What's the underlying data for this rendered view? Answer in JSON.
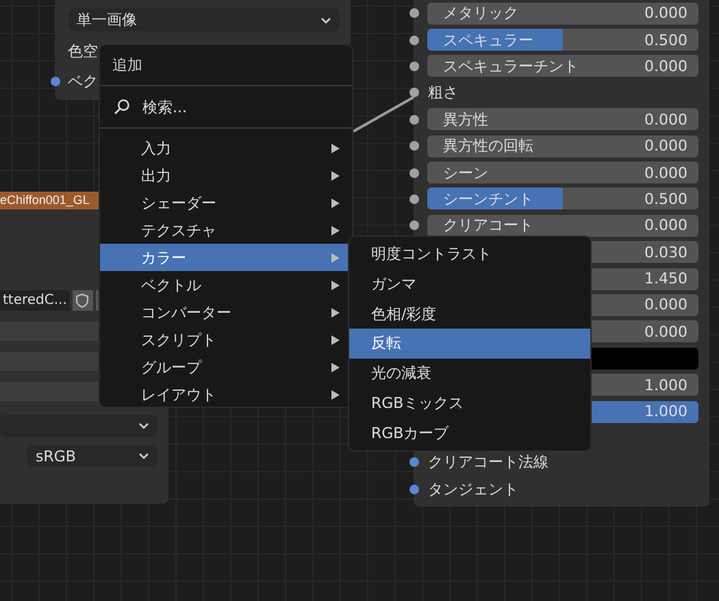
{
  "image_node": {
    "dropdown": "単一画像",
    "rows": [
      {
        "label": "色空"
      },
      {
        "label": "ベク",
        "color": "#5b84d6"
      }
    ]
  },
  "texture_node": {
    "title": "eChiffon001_GL",
    "image_field": "tteredC...",
    "colorspace": "sRGB"
  },
  "add_menu": {
    "title": "追加",
    "search": "検索...",
    "items": [
      {
        "label": "入力",
        "selected": false
      },
      {
        "label": "出力",
        "selected": false
      },
      {
        "label": "シェーダー",
        "selected": false
      },
      {
        "label": "テクスチャ",
        "selected": false
      },
      {
        "label": "カラー",
        "selected": true
      },
      {
        "label": "ベクトル",
        "selected": false
      },
      {
        "label": "コンバーター",
        "selected": false
      },
      {
        "label": "スクリプト",
        "selected": false
      },
      {
        "label": "グループ",
        "selected": false
      },
      {
        "label": "レイアウト",
        "selected": false
      }
    ]
  },
  "color_submenu": {
    "items": [
      {
        "label": "明度コントラスト",
        "selected": false
      },
      {
        "label": "ガンマ",
        "selected": false
      },
      {
        "label": "色相/彩度",
        "selected": false
      },
      {
        "label": "反転",
        "selected": true
      },
      {
        "label": "光の減衰",
        "selected": false
      },
      {
        "label": "RGBミックス",
        "selected": false
      },
      {
        "label": "RGBカーブ",
        "selected": false
      }
    ]
  },
  "bsdf_node": {
    "rows": [
      {
        "kind": "slider",
        "label": "メタリック",
        "value": "0.000",
        "level": 0,
        "color": "#a1a1a1"
      },
      {
        "kind": "slider",
        "label": "スペキュラー",
        "value": "0.500",
        "level": 0.5,
        "color": "#a1a1a1"
      },
      {
        "kind": "slider",
        "label": "スペキュラーチント",
        "value": "0.000",
        "level": 0,
        "color": "#a1a1a1"
      },
      {
        "kind": "label",
        "label": "粗さ",
        "color": "#a1a1a1"
      },
      {
        "kind": "slider",
        "label": "異方性",
        "value": "0.000",
        "level": 0,
        "color": "#a1a1a1"
      },
      {
        "kind": "slider",
        "label": "異方性の回転",
        "value": "0.000",
        "level": 0,
        "color": "#a1a1a1"
      },
      {
        "kind": "slider",
        "label": "シーン",
        "value": "0.000",
        "level": 0,
        "color": "#a1a1a1"
      },
      {
        "kind": "slider",
        "label": "シーンチント",
        "value": "0.500",
        "level": 0.5,
        "color": "#a1a1a1"
      },
      {
        "kind": "slider",
        "label": "クリアコート",
        "value": "0.000",
        "level": 0,
        "color": "#a1a1a1"
      },
      {
        "kind": "slider",
        "value": "0.030",
        "level": 0.03
      },
      {
        "kind": "number",
        "value": "1.450"
      },
      {
        "kind": "slider",
        "value": "0.000",
        "level": 0
      },
      {
        "kind": "slider",
        "value": "0.000",
        "level": 0
      },
      {
        "kind": "color",
        "color": "#000000"
      },
      {
        "kind": "number",
        "value": "1.000"
      },
      {
        "kind": "slider",
        "value": "1.000",
        "level": 1
      }
    ],
    "inputs": [
      {
        "label": "クリアコート法線",
        "color": "#5b84d6"
      },
      {
        "label": "タンジェント",
        "color": "#5b84d6"
      }
    ]
  }
}
